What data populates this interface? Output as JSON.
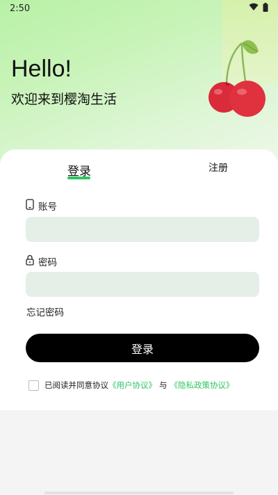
{
  "status_bar": {
    "time": "2:50"
  },
  "hero": {
    "greeting": "Hello!",
    "subtitle": "欢迎来到樱淘生活"
  },
  "tabs": {
    "login": "登录",
    "register": "注册"
  },
  "form": {
    "account_label": "账号",
    "account_value": "",
    "password_label": "密码",
    "password_value": "",
    "forgot_label": "忘记密码",
    "submit_label": "登录"
  },
  "agreement": {
    "prefix": "已阅读并同意协议",
    "user_agreement": "《用户协议》",
    "connector": "与",
    "privacy_policy": "《隐私政策协议》",
    "checked": false
  },
  "icons": {
    "phone": "phone-icon",
    "lock": "lock-icon",
    "wifi": "wifi-icon",
    "battery": "battery-icon",
    "cherry": "cherry-illustration"
  },
  "colors": {
    "accent": "#2fc561",
    "button": "#000000",
    "input_bg": "#e6efe7"
  }
}
